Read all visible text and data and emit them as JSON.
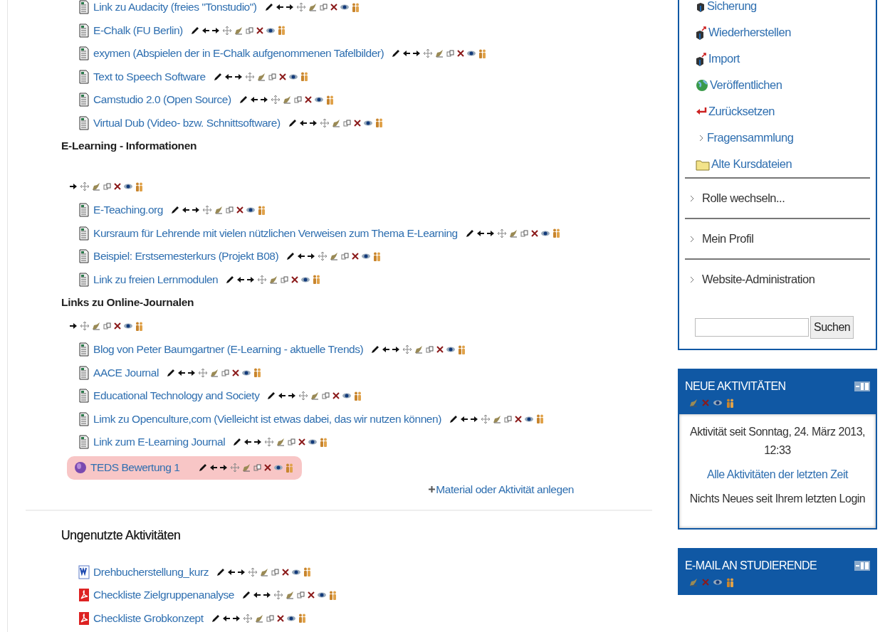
{
  "sections": [
    {
      "items": [
        {
          "kind": "resource",
          "label": "Link zu Audacity (freies \"Tonstudio\")",
          "highlighted": false
        },
        {
          "kind": "resource",
          "label": "E-Chalk (FU Berlin)",
          "highlighted": false
        },
        {
          "kind": "resource",
          "label": "exymen (Abspielen der in E-Chalk aufgenommenen Tafelbilder)",
          "highlighted": false
        },
        {
          "kind": "resource",
          "label": "Text to Speech Software",
          "highlighted": false
        },
        {
          "kind": "resource",
          "label": "Camstudio 2.0 (Open Source)",
          "highlighted": false
        },
        {
          "kind": "resource",
          "label": "Virtual Dub (Video- bzw. Schnittsoftware)",
          "highlighted": false
        }
      ]
    },
    {
      "title": "E-Learning - Informationen",
      "items": [
        {
          "kind": "resource",
          "label": "E-Teaching.org",
          "highlighted": false
        },
        {
          "kind": "resource",
          "label": "Kursraum für Lehrende mit vielen nützlichen Verweisen zum Thema E-Learning",
          "highlighted": false
        },
        {
          "kind": "resource",
          "label": "Beispiel: Erstsemesterkurs (Projekt B08)",
          "highlighted": false
        },
        {
          "kind": "resource",
          "label": "Link zu freien Lernmodulen",
          "highlighted": false
        }
      ]
    },
    {
      "title": "Links zu Online-Journalen",
      "items": [
        {
          "kind": "resource",
          "label": "Blog von Peter Baumgartner (E-Learning - aktuelle Trends)",
          "highlighted": false
        },
        {
          "kind": "resource",
          "label": "AACE Journal",
          "highlighted": false
        },
        {
          "kind": "resource",
          "label": "Educational Technology and Society",
          "highlighted": false
        },
        {
          "kind": "resource",
          "label": "Limk zu Openculture,com (Vielleicht ist etwas dabei, das wir nutzen können)",
          "highlighted": false
        },
        {
          "kind": "resource",
          "label": "Link zum E-Learning Journal",
          "highlighted": false
        },
        {
          "kind": "quiz",
          "label": "TEDS Bewertung  1",
          "highlighted": true
        }
      ]
    }
  ],
  "add_activity": "Material oder Aktivität anlegen",
  "orphaned": {
    "title": "Ungenutzte Aktivitäten",
    "items": [
      {
        "kind": "word",
        "label": "Drehbucherstellung_kurz",
        "highlighted": false
      },
      {
        "kind": "pdf",
        "label": "Checkliste Zielgruppenanalyse",
        "highlighted": false
      },
      {
        "kind": "pdf",
        "label": "Checkliste Grobkonzept",
        "highlighted": false
      }
    ]
  },
  "admin_block": {
    "items": [
      {
        "kind": "backup",
        "label": "Sicherung"
      },
      {
        "kind": "restore",
        "label": "Wiederherstellen"
      },
      {
        "kind": "restore",
        "label": "Import"
      },
      {
        "kind": "publish",
        "label": "Veröffentlichen"
      },
      {
        "kind": "reset",
        "label": "Zurücksetzen"
      },
      {
        "kind": "expand",
        "label": "Fragensammlung"
      },
      {
        "kind": "folder",
        "label": "Alte Kursdateien"
      }
    ],
    "nav_links": [
      "Rolle wechseln...",
      "Mein Profil",
      "Website-Administration"
    ],
    "search_button": "Suchen"
  },
  "blocks": [
    {
      "title": "NEUE AKTIVITÄTEN",
      "lines": [
        {
          "kind": "text",
          "text": "Aktivität seit Sonntag, 24. März 2013, 12:33"
        },
        {
          "kind": "link",
          "text": "Alle Aktivitäten der letzten Zeit"
        },
        {
          "kind": "text",
          "text": "Nichts Neues seit Ihrem letzten Login"
        }
      ]
    },
    {
      "title": "E-MAIL AN STUDIERENDE"
    }
  ]
}
